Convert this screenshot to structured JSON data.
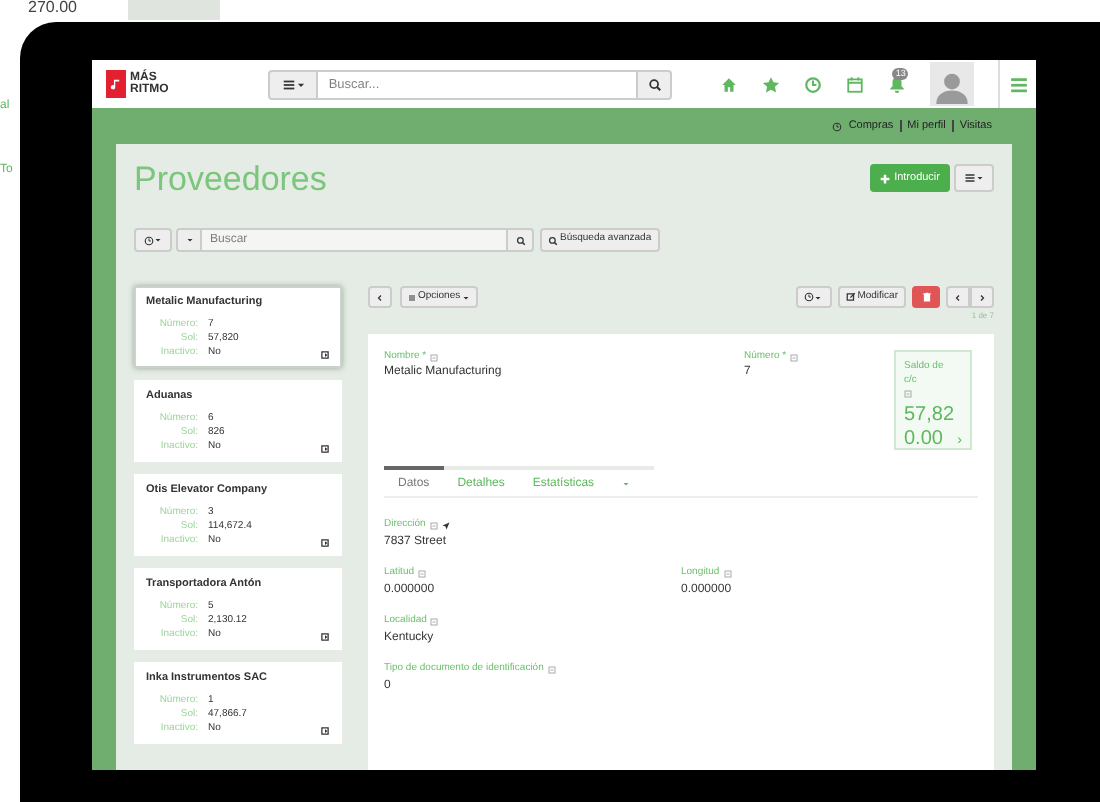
{
  "background": {
    "amount": "270.00",
    "fragments": [
      "al",
      "To"
    ]
  },
  "header": {
    "logo": {
      "line_1": "MÁS",
      "line_2": "RITMO"
    },
    "search": {
      "placeholder": "Buscar..."
    },
    "notification_count": "13"
  },
  "user_links": [
    "Compras",
    "Mi perfil",
    "Visitas"
  ],
  "page": {
    "title": "Proveedores",
    "add_button": "Introducir",
    "search": {
      "placeholder": "Buscar"
    },
    "advanced_search": "Búsqueda avanzada"
  },
  "records": [
    {
      "name": "Metalic Manufacturing",
      "selected": true,
      "fields": [
        {
          "label": "Número:",
          "value": "7"
        },
        {
          "label": "Sol:",
          "value": "57,820"
        },
        {
          "label": "Inactivo:",
          "value": "No"
        }
      ]
    },
    {
      "name": "Aduanas",
      "selected": false,
      "fields": [
        {
          "label": "Número:",
          "value": "6"
        },
        {
          "label": "Sol:",
          "value": "826"
        },
        {
          "label": "Inactivo:",
          "value": "No"
        }
      ]
    },
    {
      "name": "Otis Elevator Company",
      "selected": false,
      "fields": [
        {
          "label": "Número:",
          "value": "3"
        },
        {
          "label": "Sol:",
          "value": "114,672.4"
        },
        {
          "label": "Inactivo:",
          "value": "No"
        }
      ]
    },
    {
      "name": "Transportadora Antón",
      "selected": false,
      "fields": [
        {
          "label": "Número:",
          "value": "5"
        },
        {
          "label": "Sol:",
          "value": "2,130.12"
        },
        {
          "label": "Inactivo:",
          "value": "No"
        }
      ]
    },
    {
      "name": "Inka Instrumentos SAC",
      "selected": false,
      "fields": [
        {
          "label": "Número:",
          "value": "1"
        },
        {
          "label": "Sol:",
          "value": "47,866.7"
        },
        {
          "label": "Inactivo:",
          "value": "No"
        }
      ]
    }
  ],
  "toolbar": {
    "options": "Opciones",
    "modify": "Modificar",
    "pager": "1 de 7"
  },
  "detail": {
    "name_label": "Nombre *",
    "name": "Metalic Manufacturing",
    "number_label": "Número *",
    "number": "7",
    "balance_label": "Saldo de c/c",
    "balance": "57,82 0.00",
    "balance_arrow": "›",
    "tabs": [
      {
        "label": "Datos",
        "selected": true
      },
      {
        "label": "Detalhes",
        "selected": false
      },
      {
        "label": "Estatísticas",
        "selected": false
      }
    ],
    "fields": [
      {
        "label": "Dirección",
        "value": "7837 Street",
        "kind": "full",
        "locate": true
      },
      {
        "label": "Latitud",
        "value": "0.000000",
        "kind": "half",
        "locate": false
      },
      {
        "label": "Longitud",
        "value": "0.000000",
        "kind": "half",
        "locate": false
      },
      {
        "label": "Localidad",
        "value": "Kentucky",
        "kind": "full",
        "locate": false
      },
      {
        "label": "Tipo de documento de identificación",
        "value": "0",
        "kind": "full",
        "locate": false
      }
    ]
  }
}
